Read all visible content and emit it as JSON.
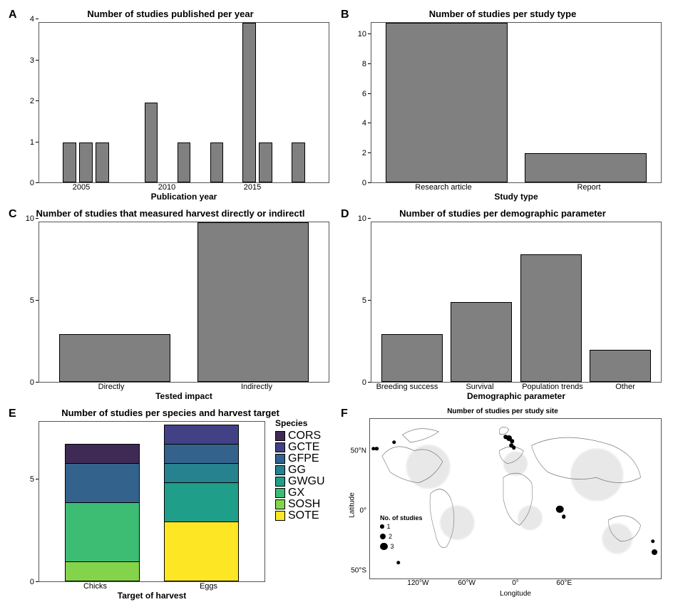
{
  "panels": {
    "A": {
      "label": "A",
      "title": "Number of studies published per year",
      "xlabel": "Publication year",
      "ylabel": "Number of studies",
      "y_ticks": [
        0,
        1,
        2,
        3,
        4
      ],
      "x_ticks": [
        2005,
        2010,
        2015
      ]
    },
    "B": {
      "label": "B",
      "title": "Number of studies per study type",
      "xlabel": "Study type",
      "ylabel": "Number of studies",
      "y_ticks": [
        0,
        2,
        4,
        6,
        8,
        10
      ]
    },
    "C": {
      "label": "C",
      "title": "Number of studies that measured harvest directly or indirectl",
      "xlabel": "Tested impact",
      "ylabel": "Number of studies",
      "y_ticks": [
        0,
        5,
        10
      ]
    },
    "D": {
      "label": "D",
      "title": "Number of studies per demographic parameter",
      "xlabel": "Demographic parameter",
      "ylabel": "Number of studies",
      "y_ticks": [
        0,
        5,
        10
      ]
    },
    "E": {
      "label": "E",
      "title": "Number of studies per species and harvest target",
      "xlabel": "Target of harvest",
      "ylabel": "Number of studies",
      "y_ticks": [
        0,
        5
      ],
      "legend_title": "Species",
      "legend_items": [
        "CORS",
        "GCTE",
        "GFPE",
        "GG",
        "GWGU",
        "GX",
        "SOSH",
        "SOTE"
      ]
    },
    "F": {
      "label": "F",
      "title": "Number of studies per study site",
      "xlabel": "Longitude",
      "ylabel": "Latitude",
      "y_ticks": [
        "50°S",
        "0°",
        "50°N"
      ],
      "x_ticks": [
        "120°W",
        "60°W",
        "0°",
        "60°E"
      ],
      "legend_title": "No. of studies",
      "legend_sizes": [
        1,
        2,
        3
      ]
    }
  },
  "species_colors": {
    "CORS": "#3f2a56",
    "GCTE": "#424186",
    "GFPE": "#33638d",
    "GG": "#26828e",
    "GWGU": "#1f9e89",
    "GX": "#3dbc74",
    "SOSH": "#84d44b",
    "SOTE": "#fde725"
  },
  "chart_data": [
    {
      "panel": "A",
      "type": "bar",
      "title": "Number of studies published per year",
      "xlabel": "Publication year",
      "ylabel": "Number of studies",
      "ylim": [
        0,
        4
      ],
      "categories": [
        2004,
        2005,
        2006,
        2009,
        2011,
        2013,
        2015,
        2016,
        2018
      ],
      "values": [
        1,
        1,
        1,
        2,
        1,
        1,
        4,
        1,
        1
      ]
    },
    {
      "panel": "B",
      "type": "bar",
      "title": "Number of studies per study type",
      "xlabel": "Study type",
      "ylabel": "Number of studies",
      "ylim": [
        0,
        11
      ],
      "categories": [
        "Research article",
        "Report"
      ],
      "values": [
        11,
        2
      ]
    },
    {
      "panel": "C",
      "type": "bar",
      "title": "Number of studies that measured harvest directly or indirectly",
      "xlabel": "Tested impact",
      "ylabel": "Number of studies",
      "ylim": [
        0,
        10
      ],
      "categories": [
        "Directly",
        "Indirectly"
      ],
      "values": [
        3,
        10
      ]
    },
    {
      "panel": "D",
      "type": "bar",
      "title": "Number of studies per demographic parameter",
      "xlabel": "Demographic parameter",
      "ylabel": "Number of studies",
      "ylim": [
        0,
        10
      ],
      "categories": [
        "Breeding success",
        "Survival",
        "Population trends",
        "Other"
      ],
      "values": [
        3,
        5,
        8,
        2
      ]
    },
    {
      "panel": "E",
      "type": "bar_stacked",
      "title": "Number of studies per species and harvest target",
      "xlabel": "Target of harvest",
      "ylabel": "Number of studies",
      "ylim": [
        0,
        8
      ],
      "categories": [
        "Chicks",
        "Eggs"
      ],
      "series": [
        {
          "name": "SOTE",
          "values": [
            0,
            3
          ]
        },
        {
          "name": "SOSH",
          "values": [
            1,
            0
          ]
        },
        {
          "name": "GX",
          "values": [
            3,
            0
          ]
        },
        {
          "name": "GWGU",
          "values": [
            0,
            2
          ]
        },
        {
          "name": "GG",
          "values": [
            0,
            1
          ]
        },
        {
          "name": "GFPE",
          "values": [
            2,
            1
          ]
        },
        {
          "name": "GCTE",
          "values": [
            0,
            1
          ]
        },
        {
          "name": "CORS",
          "values": [
            1,
            0
          ]
        }
      ],
      "totals": [
        7,
        8
      ]
    },
    {
      "panel": "F",
      "type": "scatter_map",
      "title": "Number of studies per study site",
      "xlabel": "Longitude",
      "ylabel": "Latitude",
      "xlim": [
        -180,
        180
      ],
      "ylim": [
        -70,
        80
      ],
      "size_legend": {
        "label": "No. of studies",
        "values": [
          1,
          2,
          3
        ]
      },
      "points": [
        {
          "lon": -176,
          "lat": 52,
          "n": 1
        },
        {
          "lon": -172,
          "lat": 52,
          "n": 1
        },
        {
          "lon": -150,
          "lat": 58,
          "n": 1
        },
        {
          "lon": -145,
          "lat": -55,
          "n": 1
        },
        {
          "lon": -12,
          "lat": 63,
          "n": 1
        },
        {
          "lon": -8,
          "lat": 62,
          "n": 2
        },
        {
          "lon": -4,
          "lat": 59,
          "n": 1
        },
        {
          "lon": -5,
          "lat": 55,
          "n": 1
        },
        {
          "lon": -2,
          "lat": 53,
          "n": 1
        },
        {
          "lon": 55,
          "lat": -5,
          "n": 3
        },
        {
          "lon": 60,
          "lat": -12,
          "n": 1
        },
        {
          "lon": 170,
          "lat": -35,
          "n": 1
        },
        {
          "lon": 172,
          "lat": -45,
          "n": 2
        }
      ]
    }
  ]
}
